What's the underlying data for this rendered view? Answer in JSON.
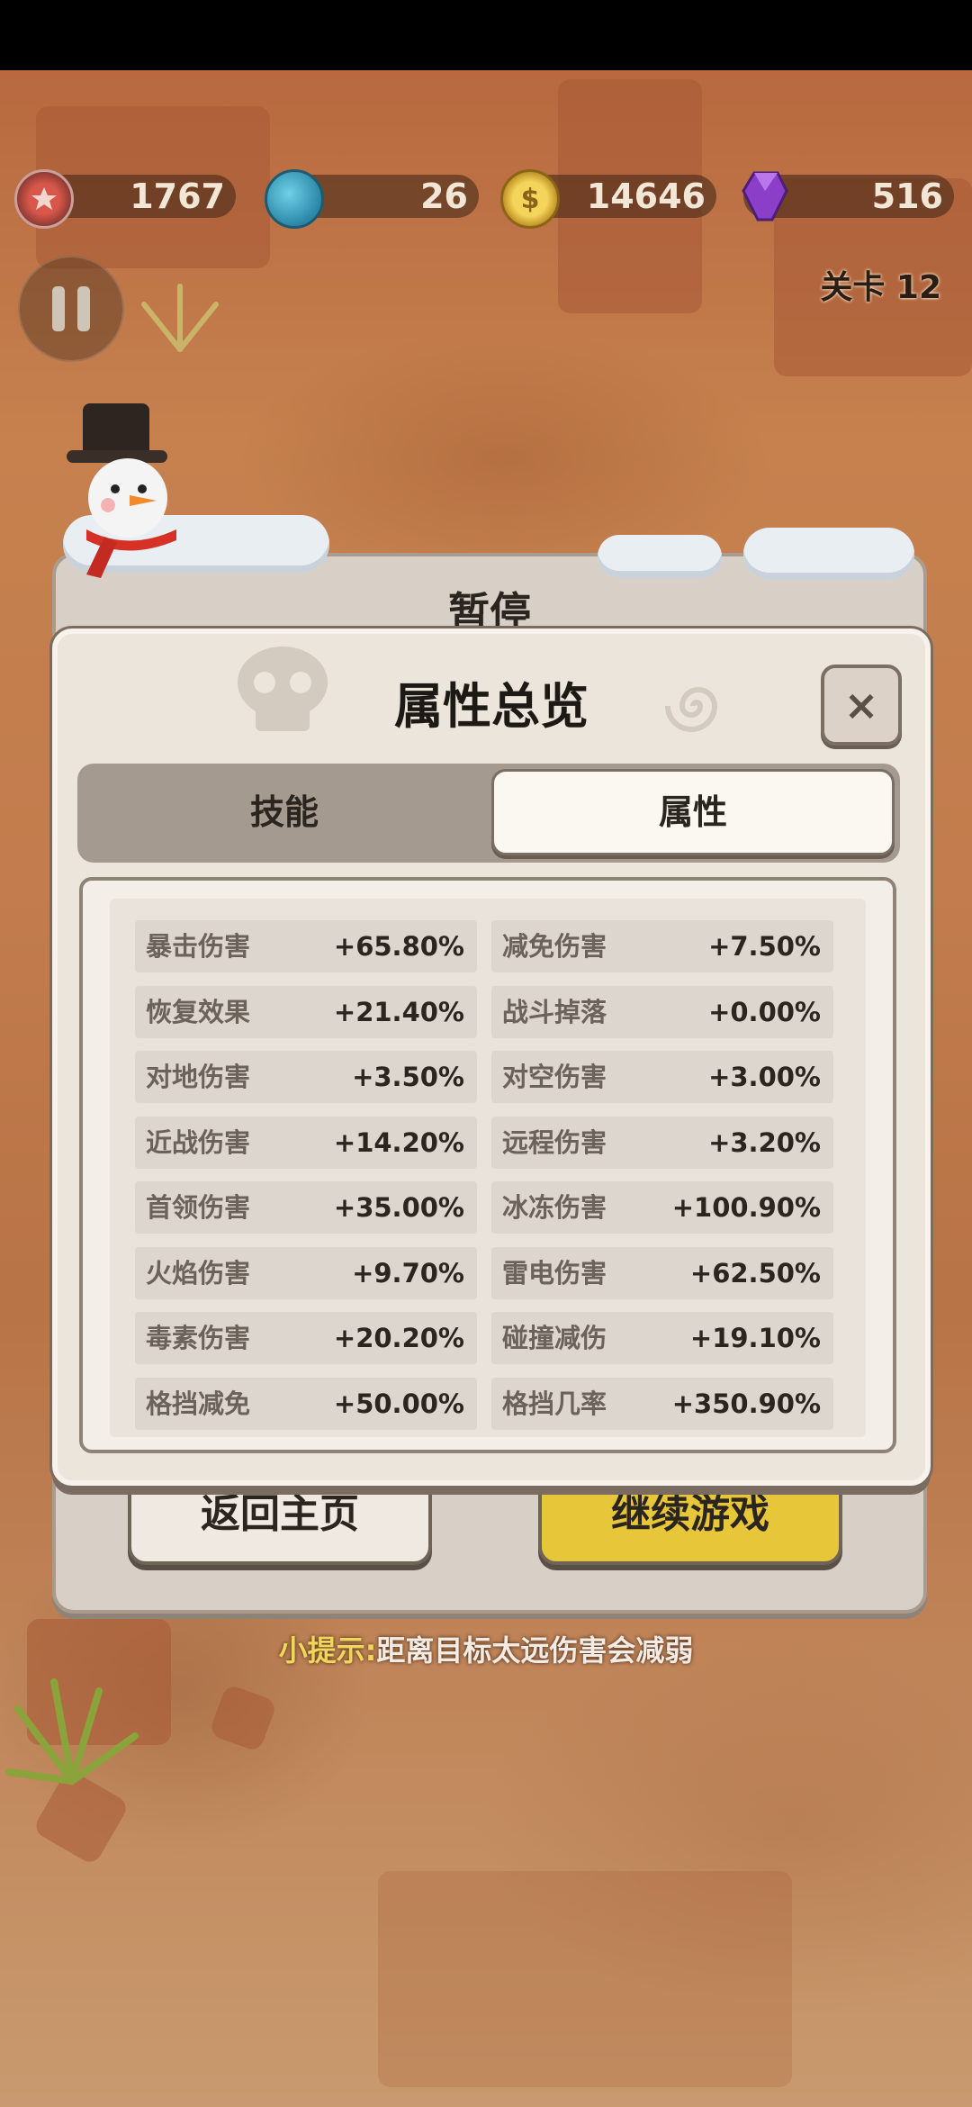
{
  "resources": [
    {
      "icon": "medal-icon",
      "value": "1767"
    },
    {
      "icon": "globe-icon",
      "value": "26"
    },
    {
      "icon": "coin-icon",
      "value": "14646"
    },
    {
      "icon": "gem-icon",
      "value": "516"
    }
  ],
  "level_label": "关卡 12",
  "pause_panel": {
    "title": "暂停",
    "home_button": "返回主页",
    "continue_button": "继续游戏"
  },
  "hint": {
    "prefix": "小提示:",
    "text": "距离目标太远伤害会减弱"
  },
  "dialog": {
    "title": "属性总览",
    "close_icon": "close-icon",
    "close_label": "×",
    "tabs": [
      {
        "label": "技能",
        "active": false
      },
      {
        "label": "属性",
        "active": true
      }
    ],
    "stats": [
      {
        "name": "暴击伤害",
        "value": "+65.80%"
      },
      {
        "name": "减免伤害",
        "value": "+7.50%"
      },
      {
        "name": "恢复效果",
        "value": "+21.40%"
      },
      {
        "name": "战斗掉落",
        "value": "+0.00%"
      },
      {
        "name": "对地伤害",
        "value": "+3.50%"
      },
      {
        "name": "对空伤害",
        "value": "+3.00%"
      },
      {
        "name": "近战伤害",
        "value": "+14.20%"
      },
      {
        "name": "远程伤害",
        "value": "+3.20%"
      },
      {
        "name": "首领伤害",
        "value": "+35.00%"
      },
      {
        "name": "冰冻伤害",
        "value": "+100.90%"
      },
      {
        "name": "火焰伤害",
        "value": "+9.70%"
      },
      {
        "name": "雷电伤害",
        "value": "+62.50%"
      },
      {
        "name": "毒素伤害",
        "value": "+20.20%"
      },
      {
        "name": "碰撞减伤",
        "value": "+19.10%"
      },
      {
        "name": "格挡减免",
        "value": "+50.00%"
      },
      {
        "name": "格挡几率",
        "value": "+350.90%"
      }
    ]
  },
  "colors": {
    "accent_yellow": "#e8c63a",
    "hint_prefix": "#f0d65a",
    "panel_bg": "#ece5dc"
  }
}
